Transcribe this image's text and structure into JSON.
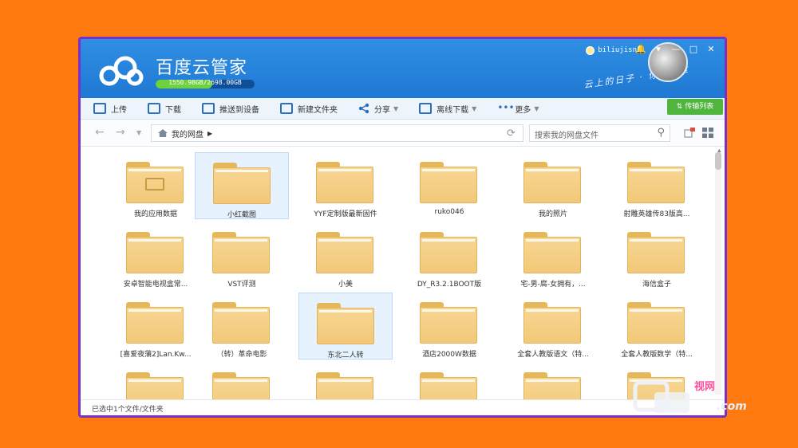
{
  "app": {
    "title": "百度云管家",
    "quota_text": "1550.98GB/2698.00GB",
    "quota_used_fraction": 0.575,
    "username": "biliujisn",
    "slogan": "云上的日子 · 你我共享"
  },
  "window_controls": [
    "🔔",
    "▾",
    "—",
    "□",
    "✕"
  ],
  "toolbar": {
    "items": [
      {
        "label": "上传",
        "icon": "upload-icon"
      },
      {
        "label": "下载",
        "icon": "download-icon"
      },
      {
        "label": "推送到设备",
        "icon": "push-device-icon"
      },
      {
        "label": "新建文件夹",
        "icon": "new-folder-icon"
      },
      {
        "label": "分享",
        "icon": "share-icon"
      },
      {
        "label": "离线下载",
        "icon": "offline-download-icon"
      },
      {
        "label": "更多",
        "icon": "more-icon"
      }
    ],
    "transfer_label": "传输列表"
  },
  "nav": {
    "breadcrumb": "我的网盘",
    "search_placeholder": "搜索我的网盘文件"
  },
  "files": [
    {
      "name": "我的应用数据",
      "selected": false,
      "special": true
    },
    {
      "name": "小红截图",
      "selected": true
    },
    {
      "name": "YYF定制版最新固件",
      "selected": false
    },
    {
      "name": "ruko046",
      "selected": false
    },
    {
      "name": "我的照片",
      "selected": false
    },
    {
      "name": "射雕英雄传83版高...",
      "selected": false
    },
    {
      "name": "安卓智能电视盒常...",
      "selected": false
    },
    {
      "name": "VST评测",
      "selected": false
    },
    {
      "name": "小美",
      "selected": false
    },
    {
      "name": "DY_R3.2.1BOOT版",
      "selected": false
    },
    {
      "name": "宅-男-腐-女拥有，...",
      "selected": false
    },
    {
      "name": "海信盒子",
      "selected": false
    },
    {
      "name": "[喜爱夜蒲2]Lan.Kw...",
      "selected": false
    },
    {
      "name": "（转）革命电影",
      "selected": false
    },
    {
      "name": "东北二人转",
      "selected": true
    },
    {
      "name": "酒店2000W数据",
      "selected": false
    },
    {
      "name": "全套人教版语文（特...",
      "selected": false
    },
    {
      "name": "全套人教版数学（特...",
      "selected": false
    },
    {
      "name": "",
      "selected": false
    },
    {
      "name": "",
      "selected": false
    },
    {
      "name": "",
      "selected": false
    },
    {
      "name": "",
      "selected": false
    },
    {
      "name": "",
      "selected": false
    },
    {
      "name": "",
      "selected": false
    }
  ],
  "status": {
    "text": "已选中1个文件/文件夹"
  },
  "watermark": {
    "line1": "视网",
    "line2": ".com"
  }
}
